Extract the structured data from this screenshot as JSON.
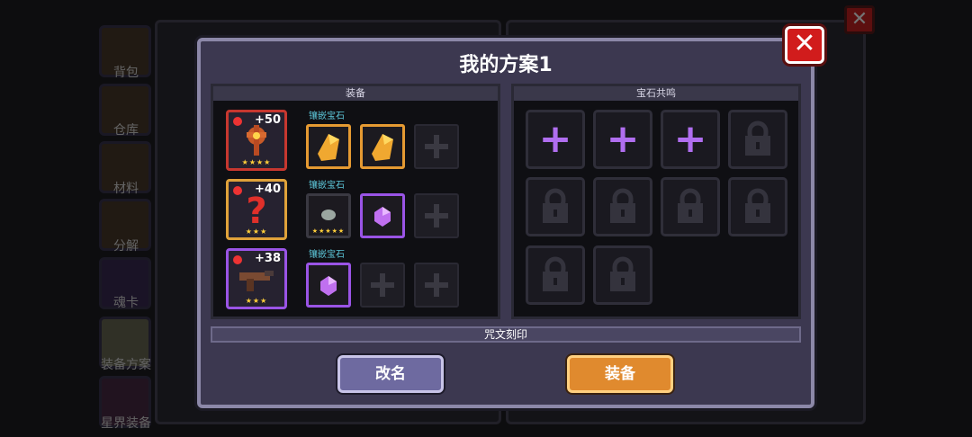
{
  "sidebar": {
    "items": [
      {
        "label": "背包"
      },
      {
        "label": "仓库"
      },
      {
        "label": "材料"
      },
      {
        "label": "分解"
      },
      {
        "label": "魂卡"
      },
      {
        "label": "装备方案"
      },
      {
        "label": "星界装备"
      }
    ]
  },
  "modal": {
    "title": "我的方案1",
    "close_label": "✕",
    "equip_header": "装备",
    "resonance_header": "宝石共鸣",
    "rune_label": "咒文刻印",
    "rename_label": "改名",
    "equip_label": "装备"
  },
  "equipment": [
    {
      "enhance": "+50",
      "stars": "★★★★",
      "gem_label": "镶嵌宝石",
      "rarity_color": "#c7372f"
    },
    {
      "enhance": "+40",
      "stars": "★★★",
      "gem_label": "镶嵌宝石",
      "rarity_color": "#e0a23a"
    },
    {
      "enhance": "+38",
      "stars": "★★★",
      "gem_label": "镶嵌宝石",
      "rarity_color": "#9a54e6"
    }
  ],
  "gem_slot_stars": "★★★★★",
  "resonance": {
    "unlocked_slots": 3,
    "total_slots": 10
  },
  "colors": {
    "accent_purple": "#b06ef0",
    "gem_orange": "#e59a32",
    "close_red": "#d11c1c",
    "equip_button": "#e08a2e",
    "rename_button": "#6e6aa0"
  }
}
